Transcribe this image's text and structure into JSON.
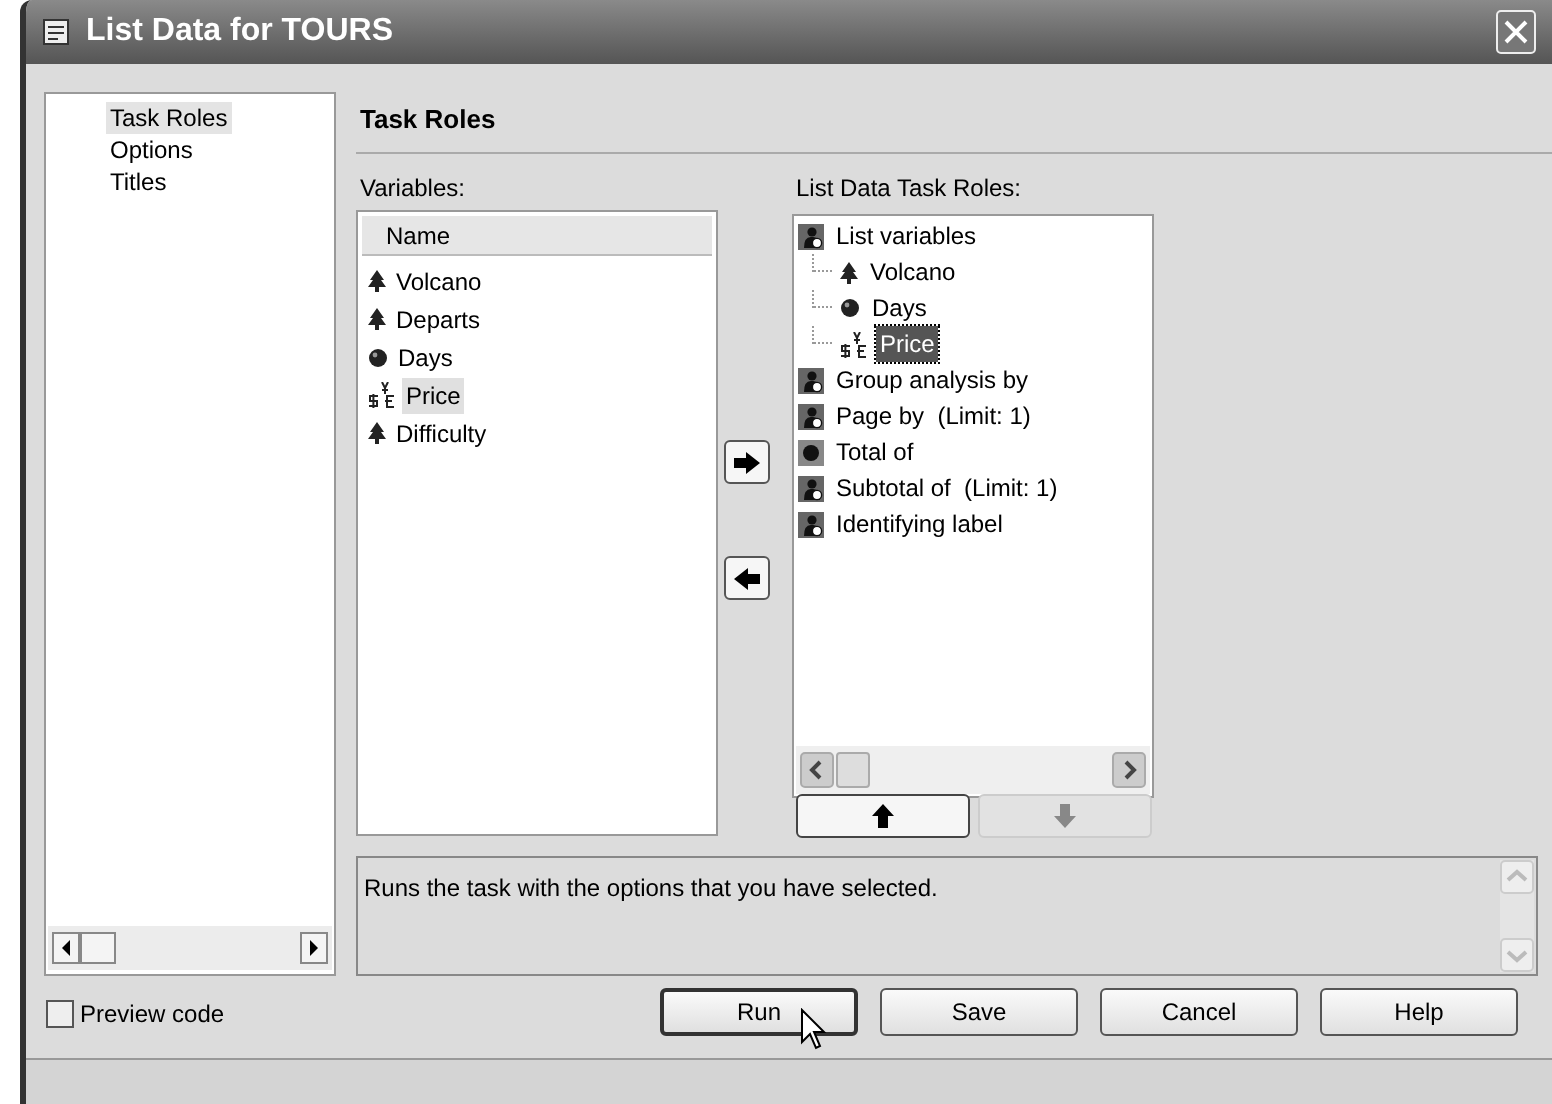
{
  "window": {
    "title": "List Data for TOURS"
  },
  "nav": {
    "items": [
      {
        "label": "Task Roles",
        "selected": true
      },
      {
        "label": "Options",
        "selected": false
      },
      {
        "label": "Titles",
        "selected": false
      }
    ]
  },
  "section_title": "Task Roles",
  "variables": {
    "label": "Variables:",
    "column": "Name",
    "items": [
      {
        "label": "Volcano",
        "kind": "character",
        "selected": false
      },
      {
        "label": "Departs",
        "kind": "character",
        "selected": false
      },
      {
        "label": "Days",
        "kind": "numeric",
        "selected": false
      },
      {
        "label": "Price",
        "kind": "currency",
        "selected": true
      },
      {
        "label": "Difficulty",
        "kind": "character",
        "selected": false
      }
    ]
  },
  "task_roles": {
    "label": "List Data Task Roles:",
    "items": [
      {
        "label": "List variables",
        "kind": "any",
        "selected": false,
        "children": [
          {
            "label": "Volcano",
            "kind": "character",
            "selected": false
          },
          {
            "label": "Days",
            "kind": "numeric",
            "selected": false
          },
          {
            "label": "Price",
            "kind": "currency",
            "selected": true
          }
        ]
      },
      {
        "label": "Group analysis by",
        "kind": "any",
        "selected": false
      },
      {
        "label": "Page by  (Limit: 1)",
        "kind": "any",
        "selected": false
      },
      {
        "label": "Total of",
        "kind": "numeric",
        "selected": false
      },
      {
        "label": "Subtotal of  (Limit: 1)",
        "kind": "any",
        "selected": false
      },
      {
        "label": "Identifying label",
        "kind": "any",
        "selected": false
      }
    ]
  },
  "description": "Runs the task with the options that you have selected.",
  "preview_code": {
    "label": "Preview code",
    "checked": false
  },
  "buttons": [
    {
      "label": "Run",
      "focused": true
    },
    {
      "label": "Save",
      "focused": false
    },
    {
      "label": "Cancel",
      "focused": false
    },
    {
      "label": "Help",
      "focused": false
    }
  ]
}
